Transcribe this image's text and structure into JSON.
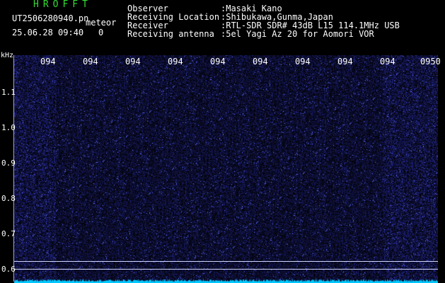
{
  "header": {
    "brand": "HROFFT",
    "file_name": "UT2506280940.pn",
    "mode": "meteor",
    "datetime": "25.06.28 09:40",
    "count": "0",
    "info": [
      {
        "label": "Observer",
        "value": ":Masaki Kano"
      },
      {
        "label": "Receiving Location",
        "value": ":Shibukawa,Gunma,Japan"
      },
      {
        "label": "Receiver",
        "value": ":RTL-SDR SDR# 43dB L15 114.1MHz USB"
      },
      {
        "label": "Receiving antenna",
        "value": ":5el Yagi Az 20 for Aomori VOR"
      }
    ]
  },
  "axes": {
    "y_unit": "kHz",
    "y_ticks": [
      "1.1",
      "1.0",
      "0.9",
      "0.8",
      "0.7",
      "0.6"
    ],
    "x_ticks": [
      "094",
      "094",
      "094",
      "094",
      "094",
      "094",
      "094",
      "094",
      "094",
      "0950"
    ]
  },
  "colors": {
    "background": "#000000",
    "brand": "#33dd33",
    "noise_floor": "#00c8ff"
  }
}
